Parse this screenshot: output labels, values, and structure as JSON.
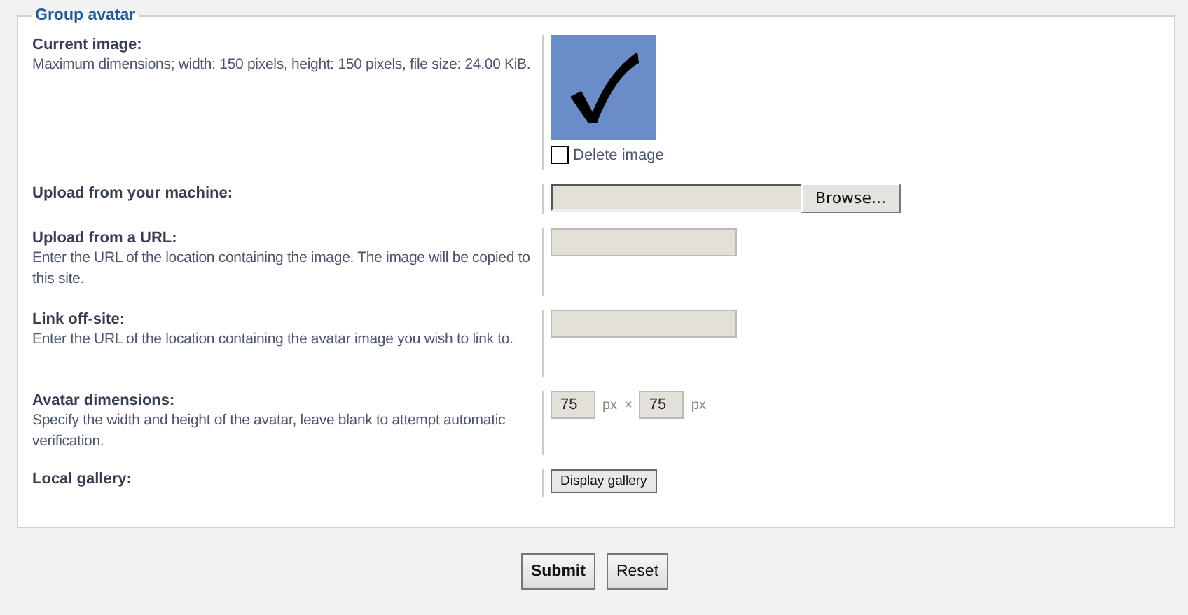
{
  "legend": "Group avatar",
  "rows": [
    {
      "kind": "image",
      "label": "Current image:",
      "description": "Maximum dimensions; width: 150 pixels, height: 150 pixels, file size: 24.00 KiB.",
      "checkbox": {
        "label": "Delete image",
        "checked": false
      }
    },
    {
      "kind": "file",
      "label": "Upload from your machine:",
      "button": "Browse..."
    },
    {
      "kind": "text",
      "label": "Upload from a URL:",
      "description": "Enter the URL of the location containing the image. The image will be copied to this site."
    },
    {
      "kind": "text",
      "label": "Link off-site:",
      "description": "Enter the URL of the location containing the avatar image you wish to link to."
    },
    {
      "kind": "dimensions",
      "label": "Avatar dimensions:",
      "description": "Specify the width and height of the avatar, leave blank to attempt automatic verification.",
      "fields": [
        {
          "value": "75",
          "unit": "px"
        },
        {
          "value": "75",
          "unit": "px"
        }
      ],
      "separator": "×"
    },
    {
      "kind": "button",
      "label": "Local gallery:",
      "button": "Display gallery"
    }
  ],
  "buttons": [
    {
      "label": "Submit",
      "primary": true
    },
    {
      "label": "Reset",
      "primary": false
    }
  ]
}
